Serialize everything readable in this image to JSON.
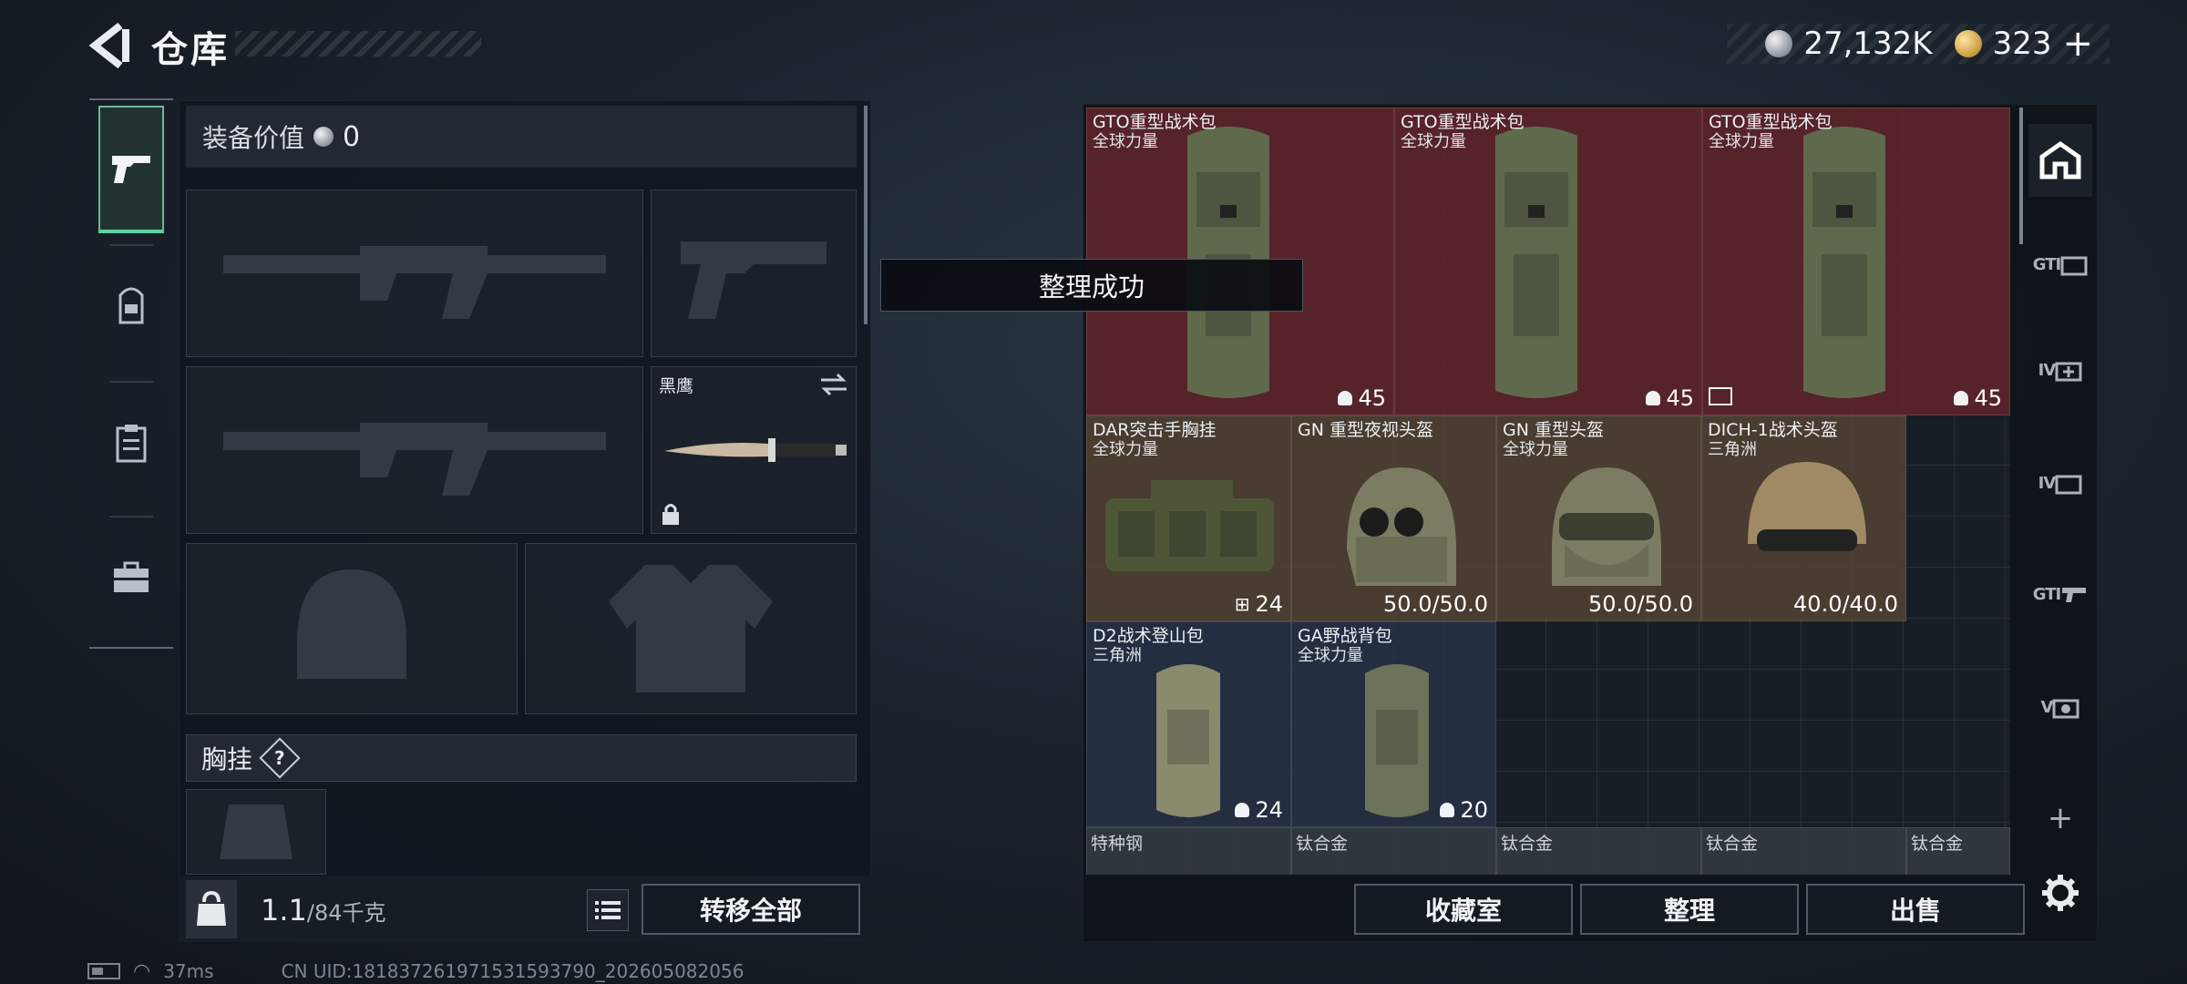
{
  "header": {
    "title": "仓库",
    "currency": [
      {
        "icon": "silver-coin-icon",
        "value": "27,132K"
      },
      {
        "icon": "gold-coin-icon",
        "value": "323"
      }
    ],
    "add_symbol": "+"
  },
  "left_tabs": [
    {
      "icon": "pistol-icon",
      "active": true
    },
    {
      "icon": "backpack-icon",
      "active": false
    },
    {
      "icon": "clipboard-icon",
      "active": false
    },
    {
      "icon": "briefcase-icon",
      "active": false
    }
  ],
  "equipment": {
    "value_label": "装备价值",
    "value": "0",
    "knife_name": "黑鹰",
    "chest_rig_label": "胸挂",
    "help_symbol": "?"
  },
  "weight": {
    "current": "1.1",
    "capacity": "/84千克",
    "icon_label": "KG"
  },
  "buttons": {
    "transfer_all": "转移全部",
    "vault": "收藏室",
    "organize": "整理",
    "sell": "出售"
  },
  "toast": "整理成功",
  "storage": {
    "items": [
      {
        "name": "GTO重型战术包",
        "sub": "全球力量",
        "stat": "45",
        "color": "red"
      },
      {
        "name": "GTO重型战术包",
        "sub": "全球力量",
        "stat": "45",
        "color": "red"
      },
      {
        "name": "GTO重型战术包",
        "sub": "全球力量",
        "stat": "45",
        "color": "red"
      },
      {
        "name": "DAR突击手胸挂",
        "sub": "全球力量",
        "stat": "24",
        "color": "brown"
      },
      {
        "name": "GN 重型夜视头盔",
        "sub": "",
        "stat": "50.0/50.0",
        "color": "brown"
      },
      {
        "name": "GN 重型头盔",
        "sub": "全球力量",
        "stat": "50.0/50.0",
        "color": "brown"
      },
      {
        "name": "DICH-1战术头盔",
        "sub": "三角洲",
        "stat": "40.0/40.0",
        "color": "brown"
      },
      {
        "name": "D2战术登山包",
        "sub": "三角洲",
        "stat": "24",
        "color": "blue"
      },
      {
        "name": "GA野战背包",
        "sub": "全球力量",
        "stat": "20",
        "color": "blue"
      }
    ],
    "bottom_row": [
      "特种钢",
      "钛合金",
      "钛合金",
      "钛合金",
      "钛合金"
    ]
  },
  "right_rail": [
    {
      "icon": "home-icon",
      "label": ""
    },
    {
      "icon": "gti-box-icon",
      "label": "GTI"
    },
    {
      "icon": "iv-add-icon",
      "label": "IV"
    },
    {
      "icon": "iv-box-icon",
      "label": "IV"
    },
    {
      "icon": "gti-gun-icon",
      "label": "GTI"
    },
    {
      "icon": "v-camera-icon",
      "label": "V"
    },
    {
      "icon": "plus-icon",
      "label": "+"
    },
    {
      "icon": "gear-icon",
      "label": ""
    }
  ],
  "status": {
    "ping": "37ms",
    "uid": "CN UID:18183726197153159379​0_202605082056"
  }
}
